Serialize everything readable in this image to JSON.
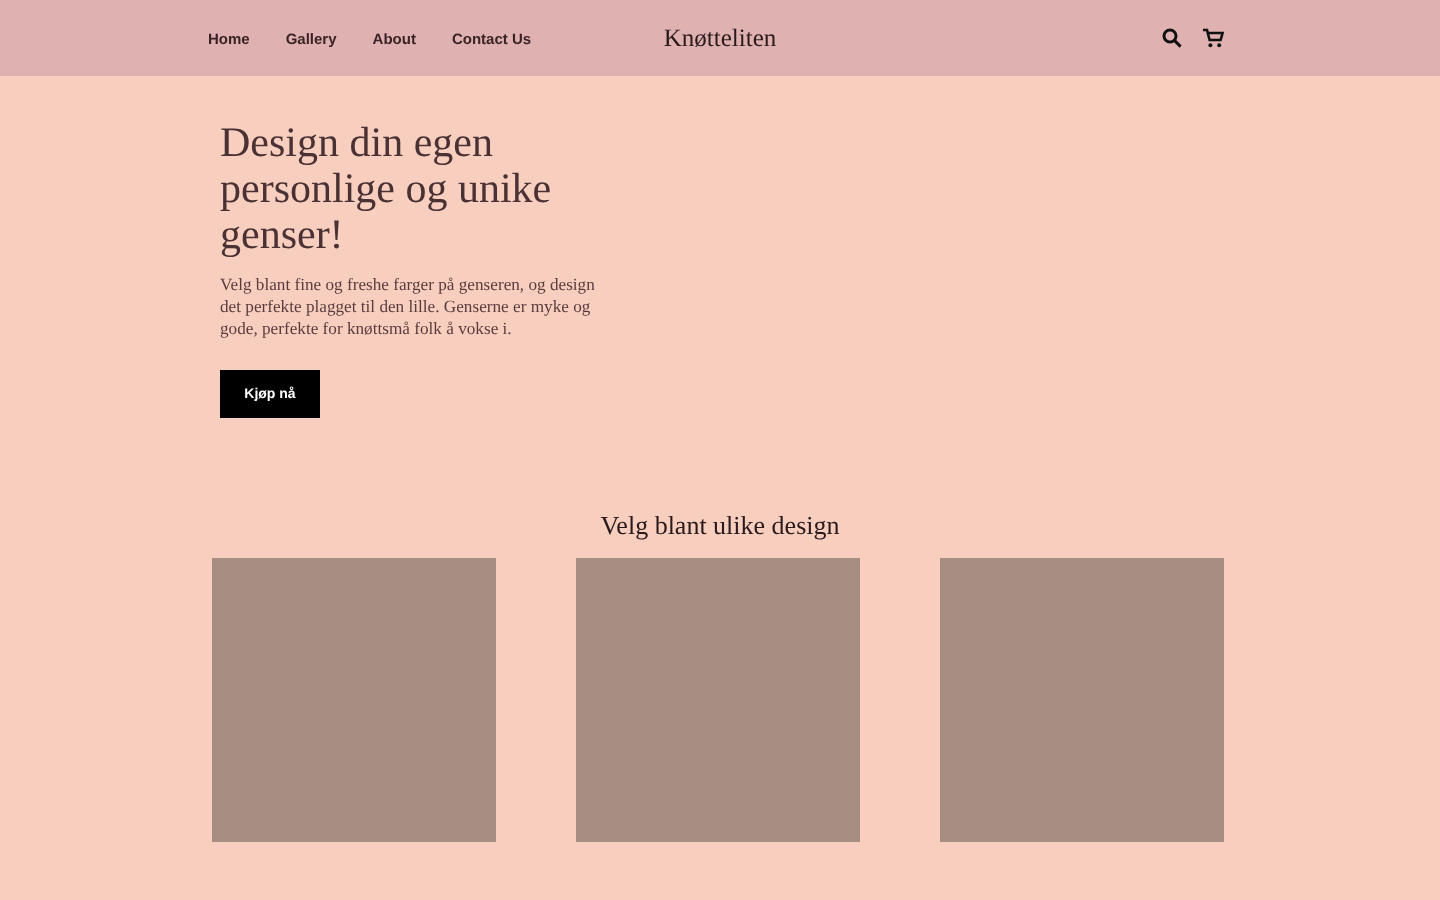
{
  "nav": {
    "links": [
      "Home",
      "Gallery",
      "About",
      "Contact Us"
    ],
    "brand": "Knøtteliten"
  },
  "hero": {
    "title": "Design din egen personlige og unike genser!",
    "text": "Velg blant fine og freshe farger på genseren, og design det perfekte plagget til den lille. Genserne er myke og gode, perfekte for knøttsmå folk å vokse i.",
    "button": "Kjøp nå"
  },
  "designs": {
    "title": "Velg blant ulike design"
  }
}
